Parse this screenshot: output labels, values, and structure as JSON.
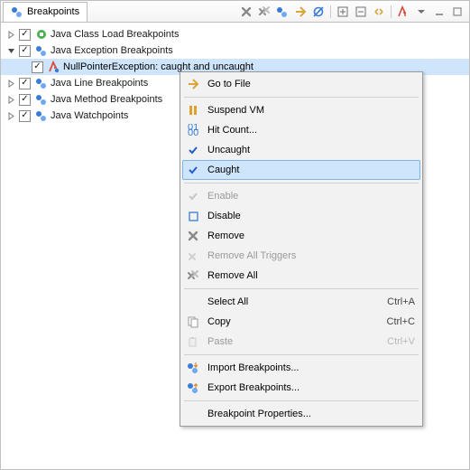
{
  "view": {
    "title": "Breakpoints"
  },
  "tree": {
    "n0": "Java Class Load Breakpoints",
    "n1": "Java Exception Breakpoints",
    "n1_0": "NullPointerException: caught and uncaught",
    "n2": "Java Line Breakpoints",
    "n3": "Java Method Breakpoints",
    "n4": "Java Watchpoints"
  },
  "menu": {
    "go_to_file": "Go to File",
    "suspend_vm": "Suspend VM",
    "hit_count": "Hit Count...",
    "uncaught": "Uncaught",
    "caught": "Caught",
    "enable": "Enable",
    "disable": "Disable",
    "remove": "Remove",
    "remove_triggers": "Remove All Triggers",
    "remove_all": "Remove All",
    "select_all": "Select All",
    "select_all_key": "Ctrl+A",
    "copy": "Copy",
    "copy_key": "Ctrl+C",
    "paste": "Paste",
    "paste_key": "Ctrl+V",
    "import_bp": "Import Breakpoints...",
    "export_bp": "Export Breakpoints...",
    "bp_props": "Breakpoint Properties..."
  }
}
